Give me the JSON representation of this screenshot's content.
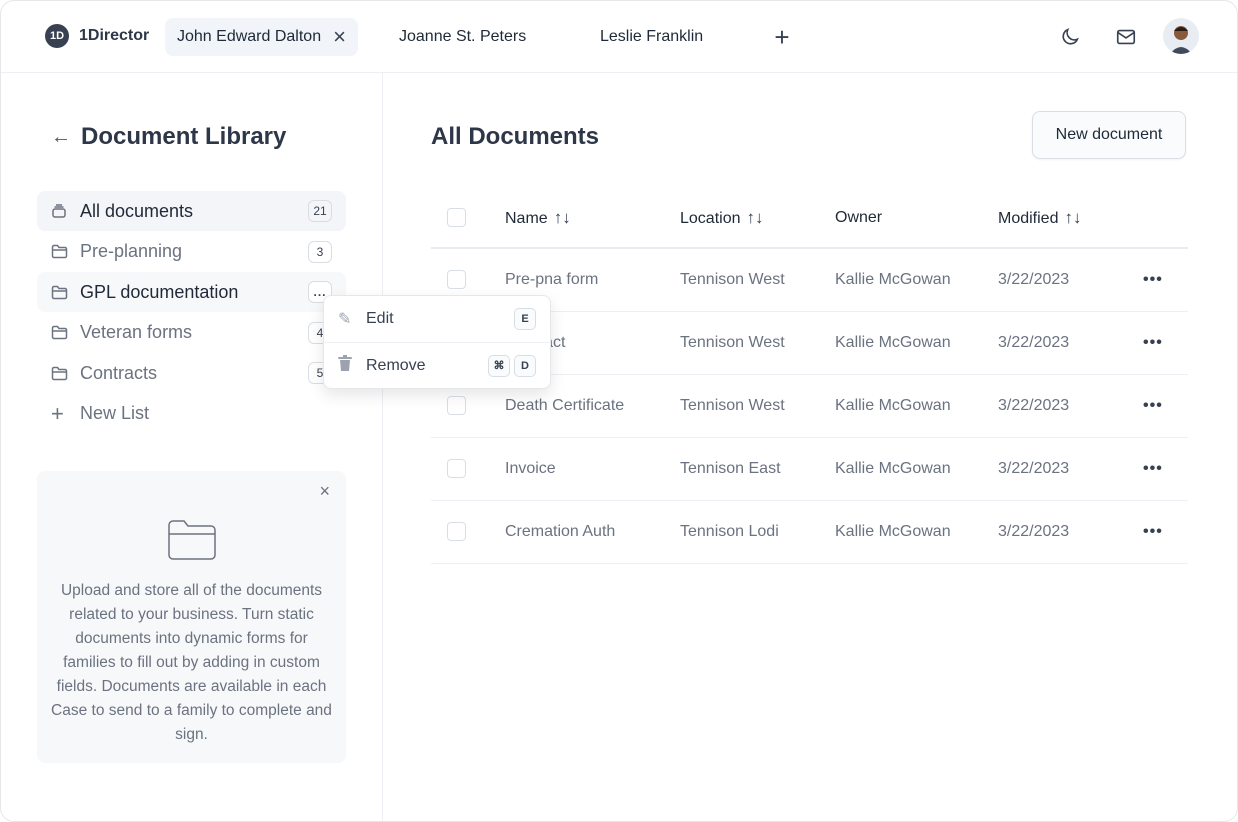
{
  "app": {
    "name": "1Director",
    "logo_mark": "1D"
  },
  "tabs": [
    {
      "label": "John Edward Dalton",
      "active": true
    },
    {
      "label": "Joanne St. Peters"
    },
    {
      "label": "Leslie Franklin"
    }
  ],
  "header_icons": [
    "plus-icon",
    "moon-icon",
    "mail-icon",
    "avatar"
  ],
  "sidebar": {
    "title": "Document Library",
    "items": [
      {
        "label": "All documents",
        "count": "21",
        "icon": "stack-icon"
      },
      {
        "label": "Pre-planning",
        "count": "3",
        "icon": "folder-icon"
      },
      {
        "label": "GPL documentation",
        "count": "...",
        "icon": "folder-icon"
      },
      {
        "label": "Veteran forms",
        "count": "4",
        "icon": "folder-icon"
      },
      {
        "label": "Contracts",
        "count": "5",
        "icon": "folder-icon"
      }
    ],
    "new_list": "New List",
    "context_menu": {
      "edit": "Edit",
      "edit_key": "E",
      "remove": "Remove",
      "remove_mod": "⌘",
      "remove_key": "D"
    },
    "info_card": {
      "text": "Upload and store all of the documents related to your business. Turn static documents into dynamic forms for families to fill out by adding in custom fields. Documents are available in each Case to send to a family to complete and sign."
    }
  },
  "main": {
    "title": "All Documents",
    "new_button": "New document",
    "columns": [
      "Name",
      "Location",
      "Owner",
      "Modified"
    ],
    "rows": [
      [
        "Pre-pna form",
        "Tennison West",
        "Kallie McGowan",
        "3/22/2023"
      ],
      [
        "Contract",
        "Tennison West",
        "Kallie McGowan",
        "3/22/2023"
      ],
      [
        "Death Certificate",
        "Tennison West",
        "Kallie McGowan",
        "3/22/2023"
      ],
      [
        "Invoice",
        "Tennison East",
        "Kallie McGowan",
        "3/22/2023"
      ],
      [
        "Cremation Auth",
        "Tennison Lodi",
        "Kallie McGowan",
        "3/22/2023"
      ]
    ]
  }
}
